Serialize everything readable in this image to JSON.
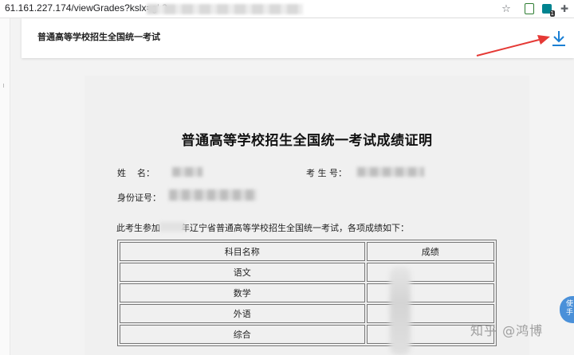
{
  "browser": {
    "url": "61.161.227.174/viewGrades?kslx=gk8",
    "icons": [
      "star-icon",
      "extension-icon",
      "badge-extension-icon",
      "puzzle-icon"
    ],
    "badge_count": "1"
  },
  "header": {
    "title": "普通高等学校招生全国统一考试",
    "download_icon": "download-icon"
  },
  "document": {
    "title": "普通高等学校招生全国统一考试成绩证明",
    "name_label": "姓    名：",
    "exam_no_label": "考 生 号：",
    "id_label": "身份证号：",
    "intro_prefix": "此考生参加",
    "intro_suffix": "年辽宁省普通高等学校招生全国统一考试，各项成绩如下：",
    "table": {
      "headers": [
        "科目名称",
        "成绩"
      ],
      "rows": [
        "语文",
        "数学",
        "外语",
        "综合"
      ]
    }
  },
  "watermark": "知乎 @鸿博",
  "side_widget": {
    "line1": "使",
    "line2": "手"
  },
  "colors": {
    "accent": "#1a7fd4",
    "arrow": "#e53935"
  }
}
